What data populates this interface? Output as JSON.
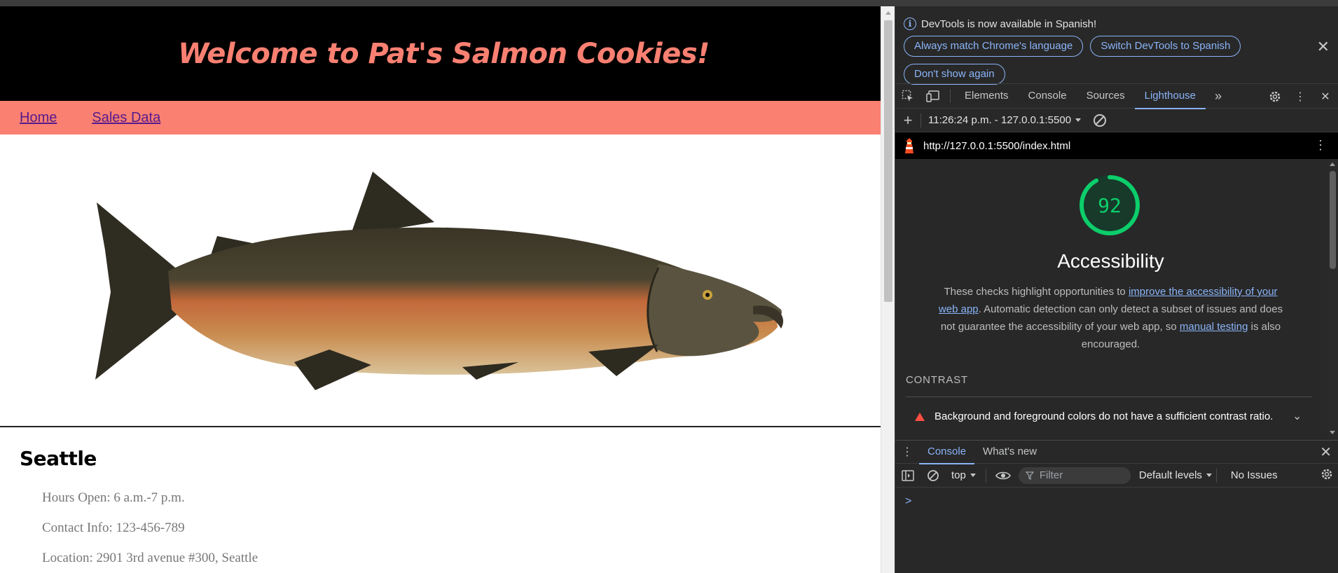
{
  "page": {
    "header_title": "Welcome to Pat's Salmon Cookies!",
    "nav": [
      {
        "label": "Home"
      },
      {
        "label": "Sales Data"
      }
    ],
    "store": {
      "name": "Seattle",
      "details": [
        "Hours Open: 6 a.m.-7 p.m.",
        "Contact Info: 123-456-789",
        "Location: 2901 3rd avenue #300, Seattle"
      ]
    }
  },
  "devtools": {
    "notice": {
      "message": "DevTools is now available in Spanish!",
      "buttons": [
        {
          "label": "Always match Chrome's language"
        },
        {
          "label": "Switch DevTools to Spanish"
        },
        {
          "label": "Don't show again"
        }
      ]
    },
    "tabs": [
      {
        "label": "Elements"
      },
      {
        "label": "Console"
      },
      {
        "label": "Sources"
      },
      {
        "label": "Lighthouse"
      }
    ],
    "active_tab": "Lighthouse",
    "report_selector": "11:26:24 p.m. - 127.0.0.1:5500",
    "url": "http://127.0.0.1:5500/index.html",
    "report": {
      "score": "92",
      "score_fraction": 0.92,
      "score_color": "#0cce6b",
      "category": "Accessibility",
      "desc_part1": "These checks highlight opportunities to ",
      "desc_link1": "improve the accessibility of your web app",
      "desc_part2": ". Automatic detection can only detect a subset of issues and does not guarantee the accessibility of your web app, so ",
      "desc_link2": "manual testing",
      "desc_part3": " is also encouraged.",
      "section": "CONTRAST",
      "audit": "Background and foreground colors do not have a sufficient contrast ratio."
    },
    "drawer": {
      "tabs": [
        {
          "label": "Console"
        },
        {
          "label": "What's new"
        }
      ],
      "context": "top",
      "filter_placeholder": "Filter",
      "levels": "Default levels",
      "issues": "No Issues",
      "prompt": ">"
    }
  },
  "colors": {
    "salmon": "#fa8072",
    "link_blue": "#8ab4f8",
    "fail_red": "#ff4e42"
  }
}
